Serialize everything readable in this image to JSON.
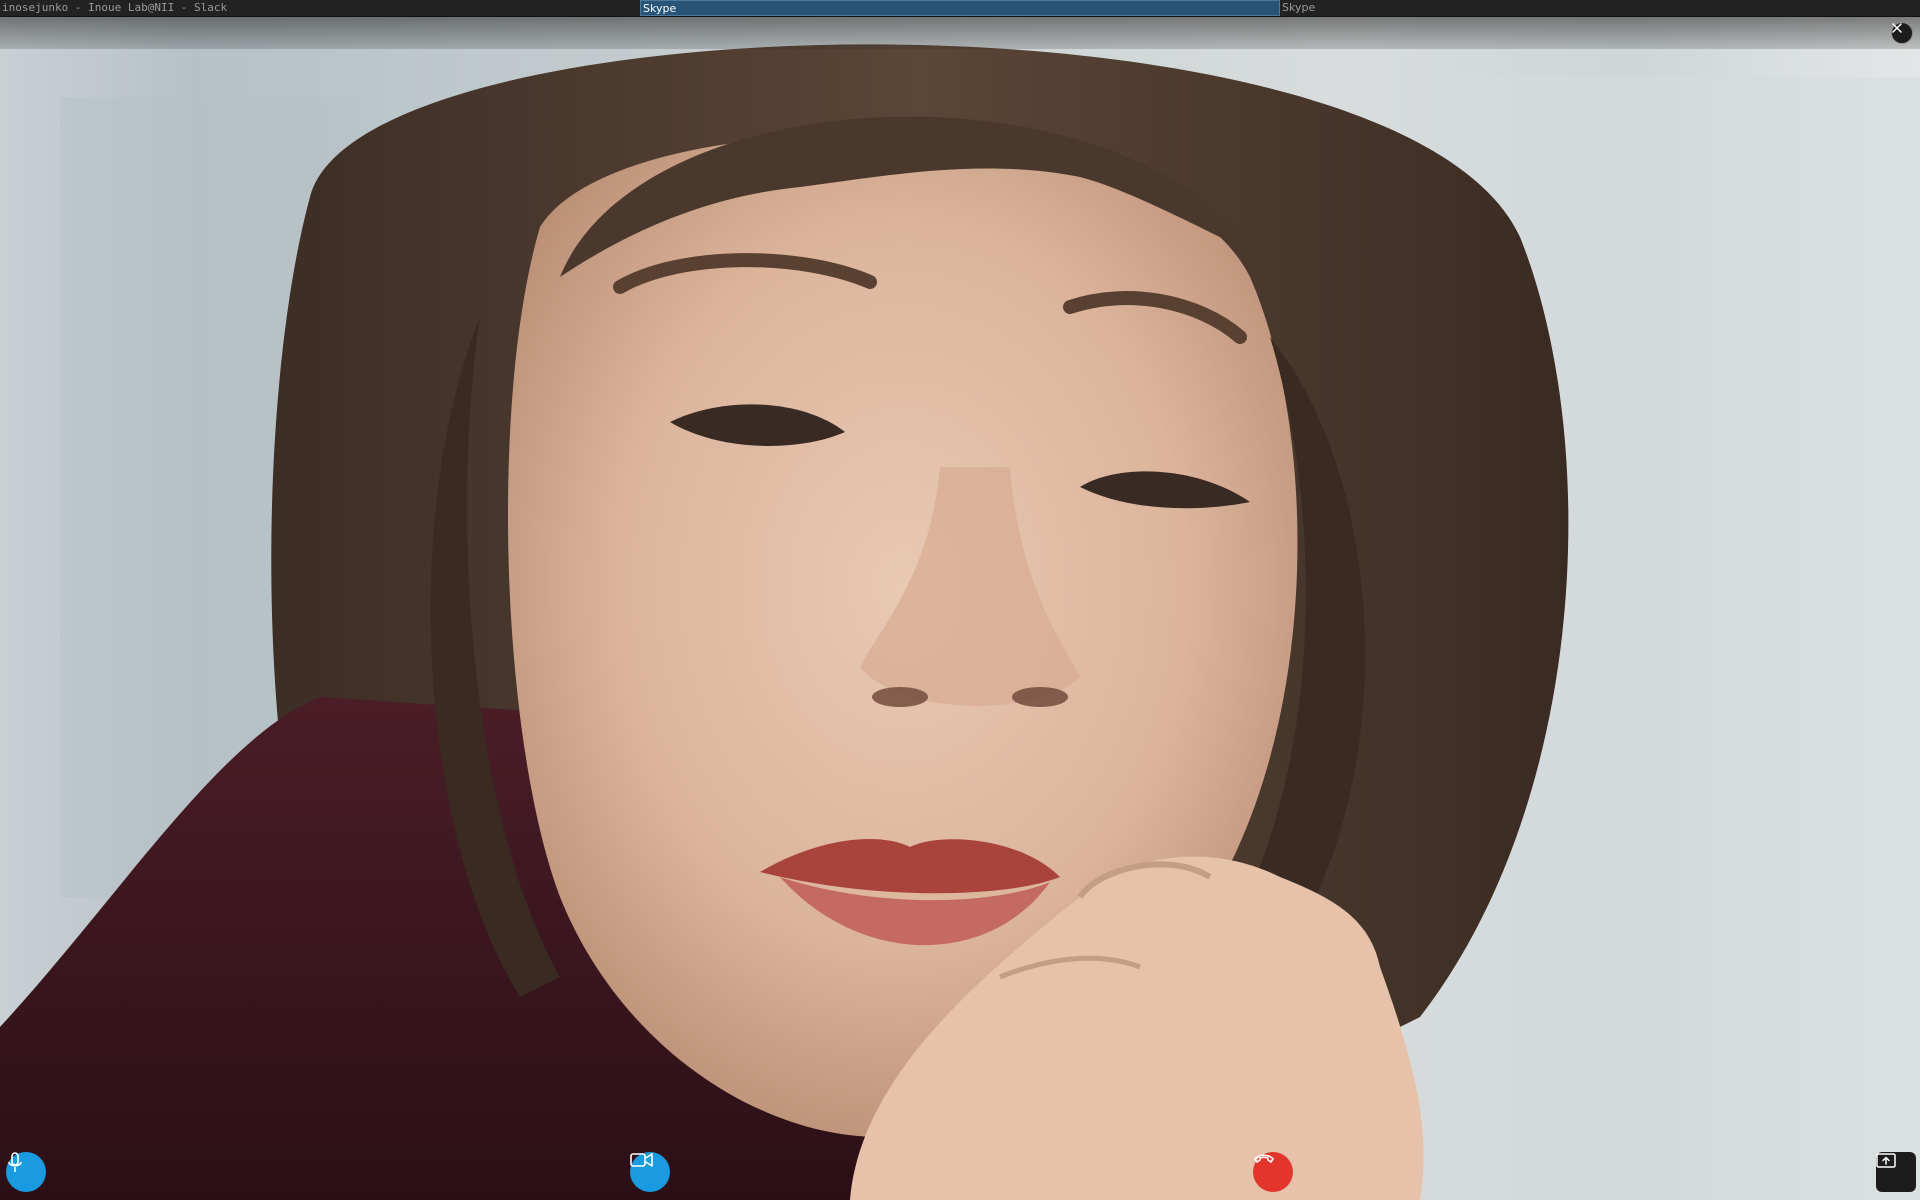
{
  "taskbar": {
    "tasks": [
      {
        "label": "inosejunko - Inoue Lab@NII - Slack",
        "active": false
      },
      {
        "label": "Skype",
        "active": true
      },
      {
        "label": "Skype",
        "active": false
      }
    ]
  },
  "call": {
    "state": "video-call-fullscreen",
    "controls": {
      "mic_icon": "microphone-icon",
      "camera_icon": "video-camera-icon",
      "end_icon": "hang-up-icon",
      "share_icon": "screen-share-icon",
      "close_icon": "close-icon"
    }
  },
  "colors": {
    "accent": "#1a9be0",
    "end_call": "#e3352c",
    "taskbar_bg": "#222222",
    "taskbar_active": "#285577"
  }
}
